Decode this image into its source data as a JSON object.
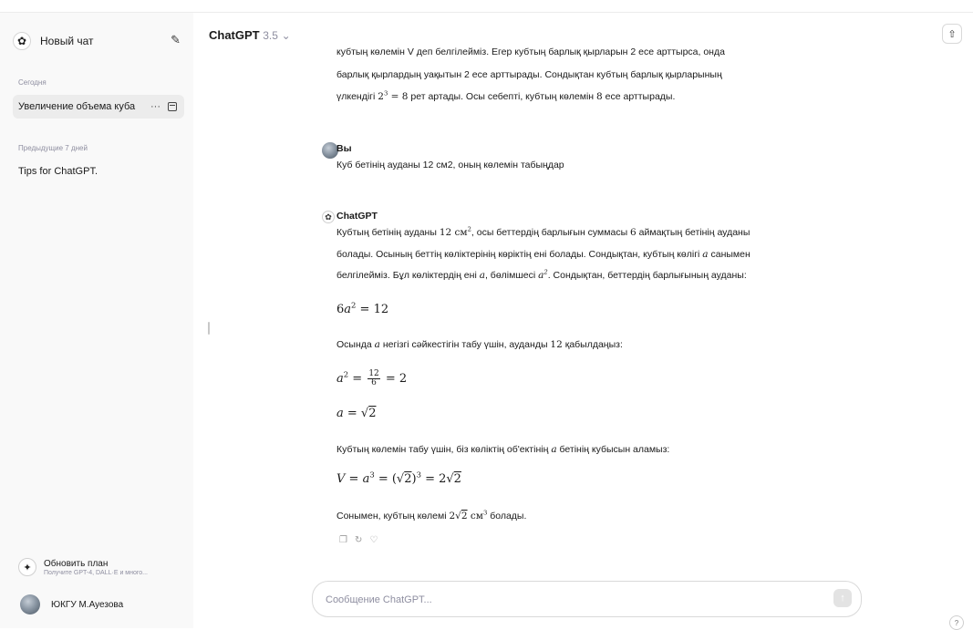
{
  "sidebar": {
    "new_chat_label": "Новый чат",
    "today_label": "Сегодня",
    "active_chat": "Увеличение объема куба",
    "previous_label": "Предыдущие 7 дней",
    "previous_chats": [
      "Tips for ChatGPT."
    ],
    "upgrade_title": "Обновить план",
    "upgrade_subtitle": "Получите GPT-4, DALL·E и много...",
    "user_name": "ЮКГУ М.Ауезова"
  },
  "header": {
    "model_name": "ChatGPT",
    "model_version": "3.5"
  },
  "conversation": {
    "prev_answer_line1": "кубтың көлемін V деп белгілейміз. Егер кубтың барлық қырларын 2 есе арттырса, онда",
    "prev_answer_line2": "барлық қырлардың уақытын 2 есе арттырады. Сондықтан кубтың барлық қырларының",
    "prev_answer_line3_a": "үлкендігі",
    "prev_answer_line3_b": "рет артады. Осы себепті, кубтың көлемін",
    "prev_answer_line3_c": "есе арттырады.",
    "user_author": "Вы",
    "user_message": "Куб бетінің ауданы 12 см2, оның көлемін табыңдар",
    "gpt_author": "ChatGPT",
    "answer_p1_a": "Кубтың бетінің ауданы",
    "answer_p1_b": ", осы беттердің барлығын суммасы",
    "answer_p1_c": "аймақтың бетінің ауданы",
    "answer_p2": "болады. Осының беттің көліктерінің көріктің ені болады. Сондықтан, кубтың көлігі",
    "answer_p2_b": "санымен",
    "answer_p3_a": "белгілейміз. Бұл көліктердің ені",
    "answer_p3_b": ", бөлімшесі",
    "answer_p3_c": ". Сондықтан, беттердің барлығының ауданы:",
    "answer_p4_a": "Осында",
    "answer_p4_b": "негізгі сәйкестігін табу үшін, ауданды",
    "answer_p4_c": "қабылдаңыз:",
    "answer_p5_a": "Кубтың көлемін табу үшін, біз көліктің об'ектінің",
    "answer_p5_b": "бетінің кубысын аламыз:",
    "answer_p6_a": "Сонымен, кубтың көлемі",
    "answer_p6_b": "болады."
  },
  "composer": {
    "placeholder": "Сообщение ChatGPT..."
  }
}
